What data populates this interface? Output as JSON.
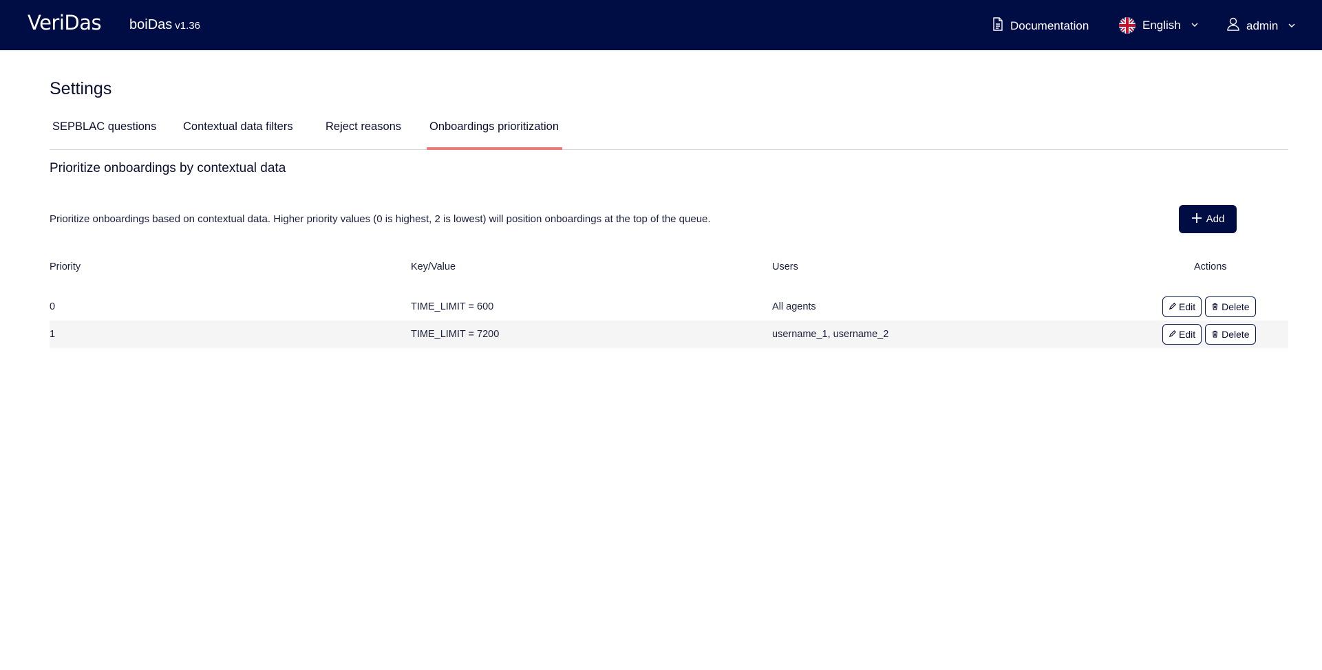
{
  "header": {
    "logo_text": "VeriDas",
    "product_name": "boiDas",
    "product_version": "v1.36",
    "documentation_label": "Documentation",
    "language_label": "English",
    "user_label": "admin",
    "bar_color": "#000d45"
  },
  "page": {
    "title": "Settings",
    "tabs": [
      {
        "label": "SEPBLAC questions",
        "active": false
      },
      {
        "label": "Contextual data filters",
        "active": false
      },
      {
        "label": "Reject reasons",
        "active": false
      },
      {
        "label": "Onboardings prioritization",
        "active": true
      }
    ],
    "accent_color": "#ec7a77"
  },
  "section": {
    "title": "Prioritize onboardings by contextual data",
    "description": "Prioritize onboardings based on contextual data. Higher priority values (0 is highest, 2 is lowest) will position onboardings at the top of the queue.",
    "add_label": "Add"
  },
  "table": {
    "headers": {
      "priority": "Priority",
      "key_value": "Key/Value",
      "users": "Users",
      "actions": "Actions"
    },
    "rows": [
      {
        "priority": "0",
        "key_value": "TIME_LIMIT = 600",
        "users": "All agents",
        "edit": "Edit",
        "delete": "Delete"
      },
      {
        "priority": "1",
        "key_value": "TIME_LIMIT = 7200",
        "users": "username_1, username_2",
        "edit": "Edit",
        "delete": "Delete"
      }
    ]
  }
}
